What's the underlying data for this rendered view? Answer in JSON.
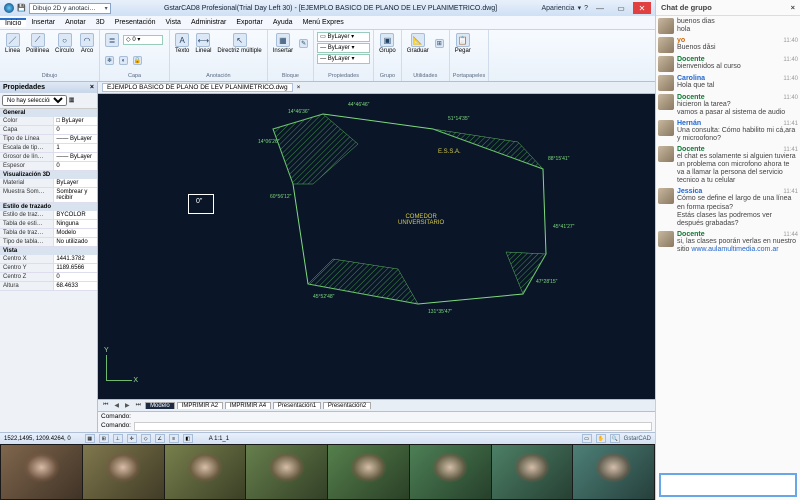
{
  "app": {
    "window_title": "GstarCAD8 Profesional(Trial Day Left 30) - [EJEMPLO BASICO DE PLANO DE LEV PLANIMETRICO.dwg]",
    "workspace_selector": "Dibujo 2D y anotaci…",
    "appearance_label": "Apariencia"
  },
  "menu": [
    "Inicio",
    "Insertar",
    "Anotar",
    "3D",
    "Presentación",
    "Vista",
    "Administrar",
    "Exportar",
    "Ayuda",
    "Menú Expres"
  ],
  "ribbon": {
    "draw": {
      "label": "Dibujo",
      "items": [
        "Línea",
        "Polilínea",
        "Círculo",
        "Arco"
      ]
    },
    "layer": {
      "label": "Capa",
      "combo": "0"
    },
    "annot": {
      "label": "Anotación",
      "items": [
        "Texto",
        "Lineal",
        "Directriz múltiple"
      ]
    },
    "block": {
      "label": "Bloque",
      "item": "Insertar"
    },
    "props": {
      "label": "Propiedades",
      "bylayer": "ByLayer"
    },
    "group": {
      "label": "Grupo",
      "item": "Grupo"
    },
    "util": {
      "label": "Utilidades",
      "item": "Graduar"
    },
    "clip": {
      "label": "Portapapeles",
      "item": "Pegar"
    }
  },
  "properties": {
    "title": "Propiedades",
    "no_selection": "No hay selección",
    "groups": [
      {
        "name": "General",
        "rows": [
          {
            "k": "Color",
            "v": "□ ByLayer"
          },
          {
            "k": "Capa",
            "v": "0"
          },
          {
            "k": "Tipo de Línea",
            "v": "—— ByLayer"
          },
          {
            "k": "Escala de tip…",
            "v": "1"
          },
          {
            "k": "Grosor de lín…",
            "v": "—— ByLayer"
          },
          {
            "k": "Espesor",
            "v": "0"
          }
        ]
      },
      {
        "name": "Visualización 3D",
        "rows": [
          {
            "k": "Material",
            "v": "ByLayer"
          },
          {
            "k": "Muestra Som…",
            "v": "Sombrear y recibir"
          }
        ]
      },
      {
        "name": "Estilo de trazado",
        "rows": [
          {
            "k": "Estilo de traz…",
            "v": "BYCOLOR"
          },
          {
            "k": "Tabla de esti…",
            "v": "Ninguna"
          },
          {
            "k": "Tabla de traz…",
            "v": "Modelo"
          },
          {
            "k": "Tipo de tabla…",
            "v": "No utilizado"
          }
        ]
      },
      {
        "name": "Vista",
        "rows": [
          {
            "k": "Centro X",
            "v": "1441.3782"
          },
          {
            "k": "Centro Y",
            "v": "1189.6566"
          },
          {
            "k": "Centro Z",
            "v": "0"
          },
          {
            "k": "Altura",
            "v": "68.4633"
          }
        ]
      }
    ]
  },
  "doc_tab": "EJEMPLO BASICO DE PLANO DE LEV PLANIMETRICO.dwg",
  "canvas": {
    "label_comedor": "COMEDOR\nUNIVERSITARIO",
    "label_essa": "E.S.S.A.",
    "dims": [
      "14°46'36\"",
      "44°46'46\"",
      "51°14'35\"",
      "88°15'41\"",
      "45°41'27\"",
      "47°28'15\"",
      "131°35'47\"",
      "45°52'48\"",
      "60°56'12\"",
      "14°06'26\""
    ],
    "cursor_label": "0\""
  },
  "bottom_tabs": {
    "model": "Modelo",
    "tabs": [
      "IMPRIMIR A2",
      "IMPRIMIR A4",
      "Presentación1",
      "Presentación2"
    ]
  },
  "command": {
    "label": "Comando:",
    "value": ""
  },
  "status": {
    "coords": "1522,1495, 1209.4264, 0",
    "scale": "A 1:1_1",
    "appname": "GstarCAD"
  },
  "chat": {
    "title": "Chat de grupo",
    "messages": [
      {
        "sender": "",
        "cls": "",
        "time": "",
        "text": "buenos dias\nhola"
      },
      {
        "sender": "yo",
        "cls": "me",
        "time": "11:40",
        "text": "Buenos dåsi"
      },
      {
        "sender": "Docente",
        "cls": "dc",
        "time": "11:40",
        "text": "bienvenidos al curso"
      },
      {
        "sender": "Carolina",
        "cls": "",
        "time": "11:40",
        "text": "Hola que tal"
      },
      {
        "sender": "Docente",
        "cls": "dc",
        "time": "11:40",
        "text": "hicieron la tarea?\nvamos a pasar al sistema de audio"
      },
      {
        "sender": "Hernán",
        "cls": "",
        "time": "11:41",
        "text": "Una consulta: Cómo habilito mi cá,ara y microofono?"
      },
      {
        "sender": "Docente",
        "cls": "dc",
        "time": "11:41",
        "text": "el chat es solamente si alguien tuviera un problema con microfono ahora te va a llamar la persona del servicio tecnico a tu celular"
      },
      {
        "sender": "Jessica",
        "cls": "",
        "time": "11:41",
        "text": "Cómo se define el largo de una línea en forma rpecisa?\nEstás clases las podremos ver después grabadas?"
      },
      {
        "sender": "Docente",
        "cls": "dc",
        "time": "11:44",
        "text": "si, las clases poorán verlas en nuestro sitio <span class='lnk'>www.aulamultimedia.com.ar</span>"
      }
    ]
  },
  "participants": 8
}
